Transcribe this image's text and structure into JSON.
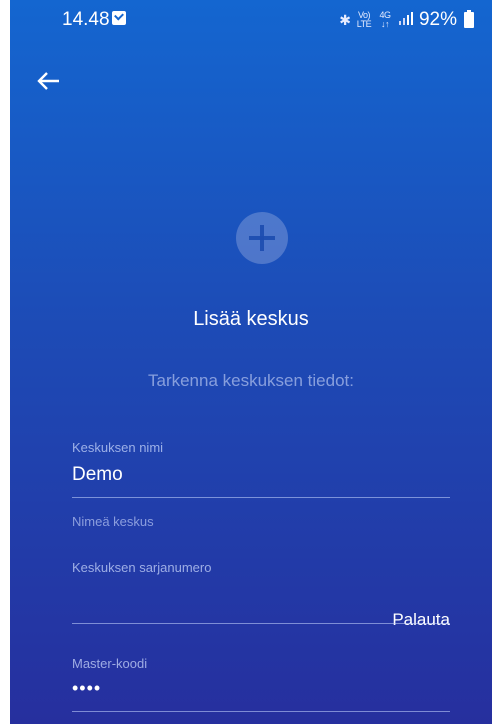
{
  "status_bar": {
    "time": "14.48",
    "battery": "92%",
    "volte_label": "VoLTE",
    "network_label": "4G"
  },
  "header": {
    "back_icon": "arrow-left-icon"
  },
  "main": {
    "add_icon": "plus-circle-icon",
    "title": "Lisää keskus",
    "subtitle": "Tarkenna keskuksen tiedot:"
  },
  "form": {
    "name_field": {
      "label": "Keskuksen nimi",
      "value": "Demo",
      "helper": "Nimeä keskus"
    },
    "serial_field": {
      "label": "Keskuksen sarjanumero",
      "value": "",
      "action_label": "Palauta"
    },
    "master_field": {
      "label": "Master-koodi",
      "value": "••••"
    }
  },
  "colors": {
    "gradient_top": "#1466d0",
    "gradient_bottom": "#262f9e",
    "text": "#ffffff"
  }
}
